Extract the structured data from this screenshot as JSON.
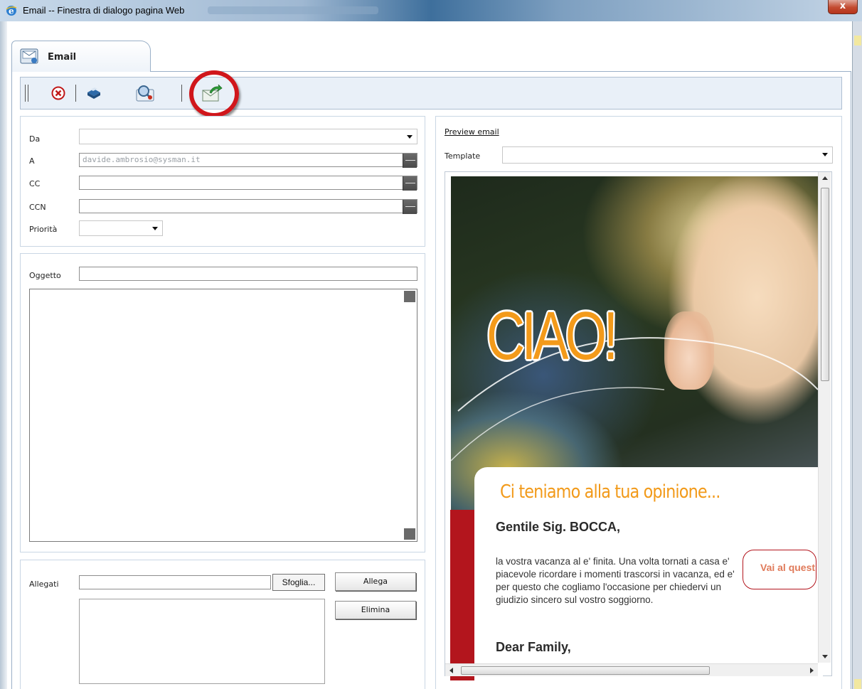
{
  "window": {
    "title": "Email -- Finestra di dialogo pagina Web",
    "close_label": "x"
  },
  "tab": {
    "label": "Email"
  },
  "toolbar": {
    "buttons": [
      "cancel-icon",
      "print-icon",
      "search-contacts-icon",
      "send-email-icon"
    ]
  },
  "address": {
    "from_label": "Da",
    "from_value": "",
    "to_label": "A",
    "to_value": "davide.ambrosio@sysman.it",
    "cc_label": "CC",
    "cc_value": "",
    "bcc_label": "CCN",
    "bcc_value": "",
    "priority_label": "Priorità",
    "priority_value": ""
  },
  "message": {
    "subject_label": "Oggetto",
    "subject_value": "",
    "body_value": ""
  },
  "attachments": {
    "label": "Allegati",
    "file_value": "",
    "browse_label": "Sfoglia...",
    "attach_label": "Allega",
    "delete_label": "Elimina"
  },
  "preview": {
    "link_label": "Preview email",
    "template_label": "Template",
    "template_value": "",
    "banner_text": "CIAO!",
    "headline": "Ci teniamo alla tua opinione...",
    "greeting": "Gentile Sig. BOCCA,",
    "body": "la vostra vacanza al e' finita. Una volta tornati a casa e' piacevole ricordare i momenti trascorsi in vacanza, ed e' per questo che cogliamo l'occasione per chiedervi un giudizio sincero sul vostro soggiorno.",
    "cta_label": "Vai al questionario",
    "greeting_en": "Dear Family,"
  },
  "colors": {
    "highlight": "#d0161b",
    "accent_orange": "#f29a1a",
    "brand_red": "#b3151d",
    "toolbar_bg": "#e9f0f8"
  }
}
